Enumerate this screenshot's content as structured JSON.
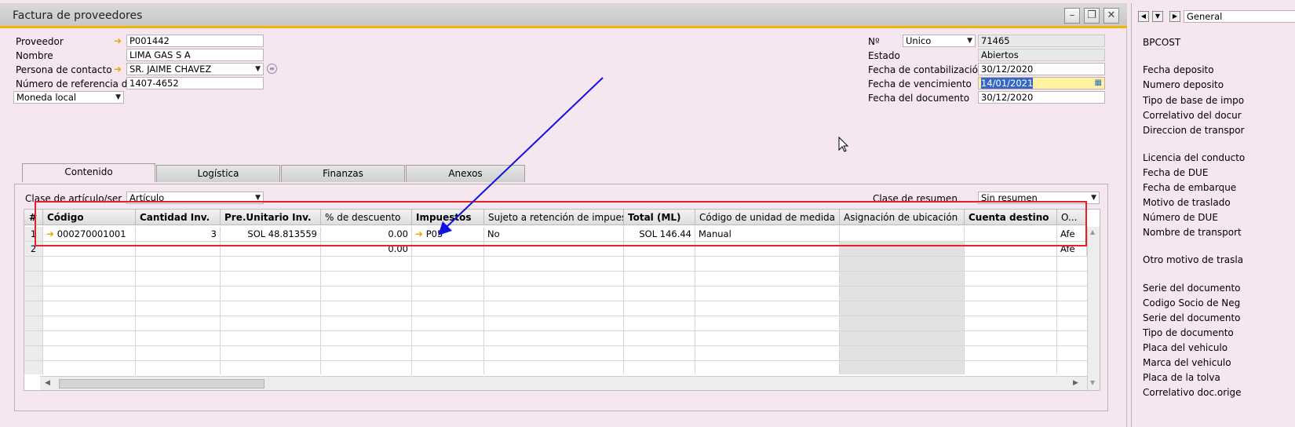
{
  "window": {
    "title": "Factura de proveedores"
  },
  "header_left": {
    "proveedor_label": "Proveedor",
    "proveedor_value": "P001442",
    "nombre_label": "Nombre",
    "nombre_value": "LIMA GAS S A",
    "contacto_label": "Persona de contacto",
    "contacto_value": "SR. JAIME CHAVEZ",
    "referencia_label": "Número de referencia d",
    "referencia_value": "1407-4652",
    "moneda_value": "Moneda local"
  },
  "header_right": {
    "no_label": "Nº",
    "serie_value": "Unico",
    "numero_value": "71465",
    "estado_label": "Estado",
    "estado_value": "Abiertos",
    "contab_label": "Fecha de contabilización",
    "contab_value": "30/12/2020",
    "venc_label": "Fecha de vencimiento",
    "venc_value": "14/01/2021",
    "doc_label": "Fecha del documento",
    "doc_value": "30/12/2020"
  },
  "tabs": [
    {
      "label": "Contenido"
    },
    {
      "label": "Logística"
    },
    {
      "label": "Finanzas"
    },
    {
      "label": "Anexos"
    }
  ],
  "panel": {
    "clase_label": "Clase de artículo/ser",
    "clase_value": "Artículo",
    "resumen_label": "Clase de resumen",
    "resumen_value": "Sin resumen"
  },
  "grid": {
    "columns": [
      "#",
      "Código",
      "Cantidad Inv.",
      "Pre.Unitario Inv.",
      "% de descuento",
      "Impuestos",
      "Sujeto a retención de impuesto",
      "Total (ML)",
      "Código de unidad de medida",
      "Asignación de ubicación",
      "Cuenta destino",
      "O..."
    ],
    "rows": [
      [
        "1",
        "000270001001",
        "3",
        "SOL 48.813559",
        "0.00",
        "P05",
        "No",
        "SOL 146.44",
        "Manual",
        "",
        "",
        "Afe"
      ],
      [
        "2",
        "",
        "",
        "",
        "0.00",
        "",
        "",
        "",
        "",
        "",
        "",
        "Afe"
      ]
    ]
  },
  "right_panel": {
    "view_value": "General",
    "labels": [
      "BPCOST",
      "Fecha deposito",
      "Numero deposito",
      "Tipo de base de impo",
      "Correlativo del docur",
      "Direccion de transpor",
      "Licencia del conducto",
      "Fecha de DUE",
      "Fecha de embarque",
      "Motivo de traslado",
      "Número de DUE",
      "Nombre de transport",
      "Otro motivo de trasla",
      "Serie del documento",
      "Codigo Socio de Neg",
      "Serie del documento",
      "Tipo de documento",
      "Placa del vehiculo",
      "Marca del vehiculo",
      "Placa de la tolva",
      "Correlativo doc.orige"
    ]
  }
}
